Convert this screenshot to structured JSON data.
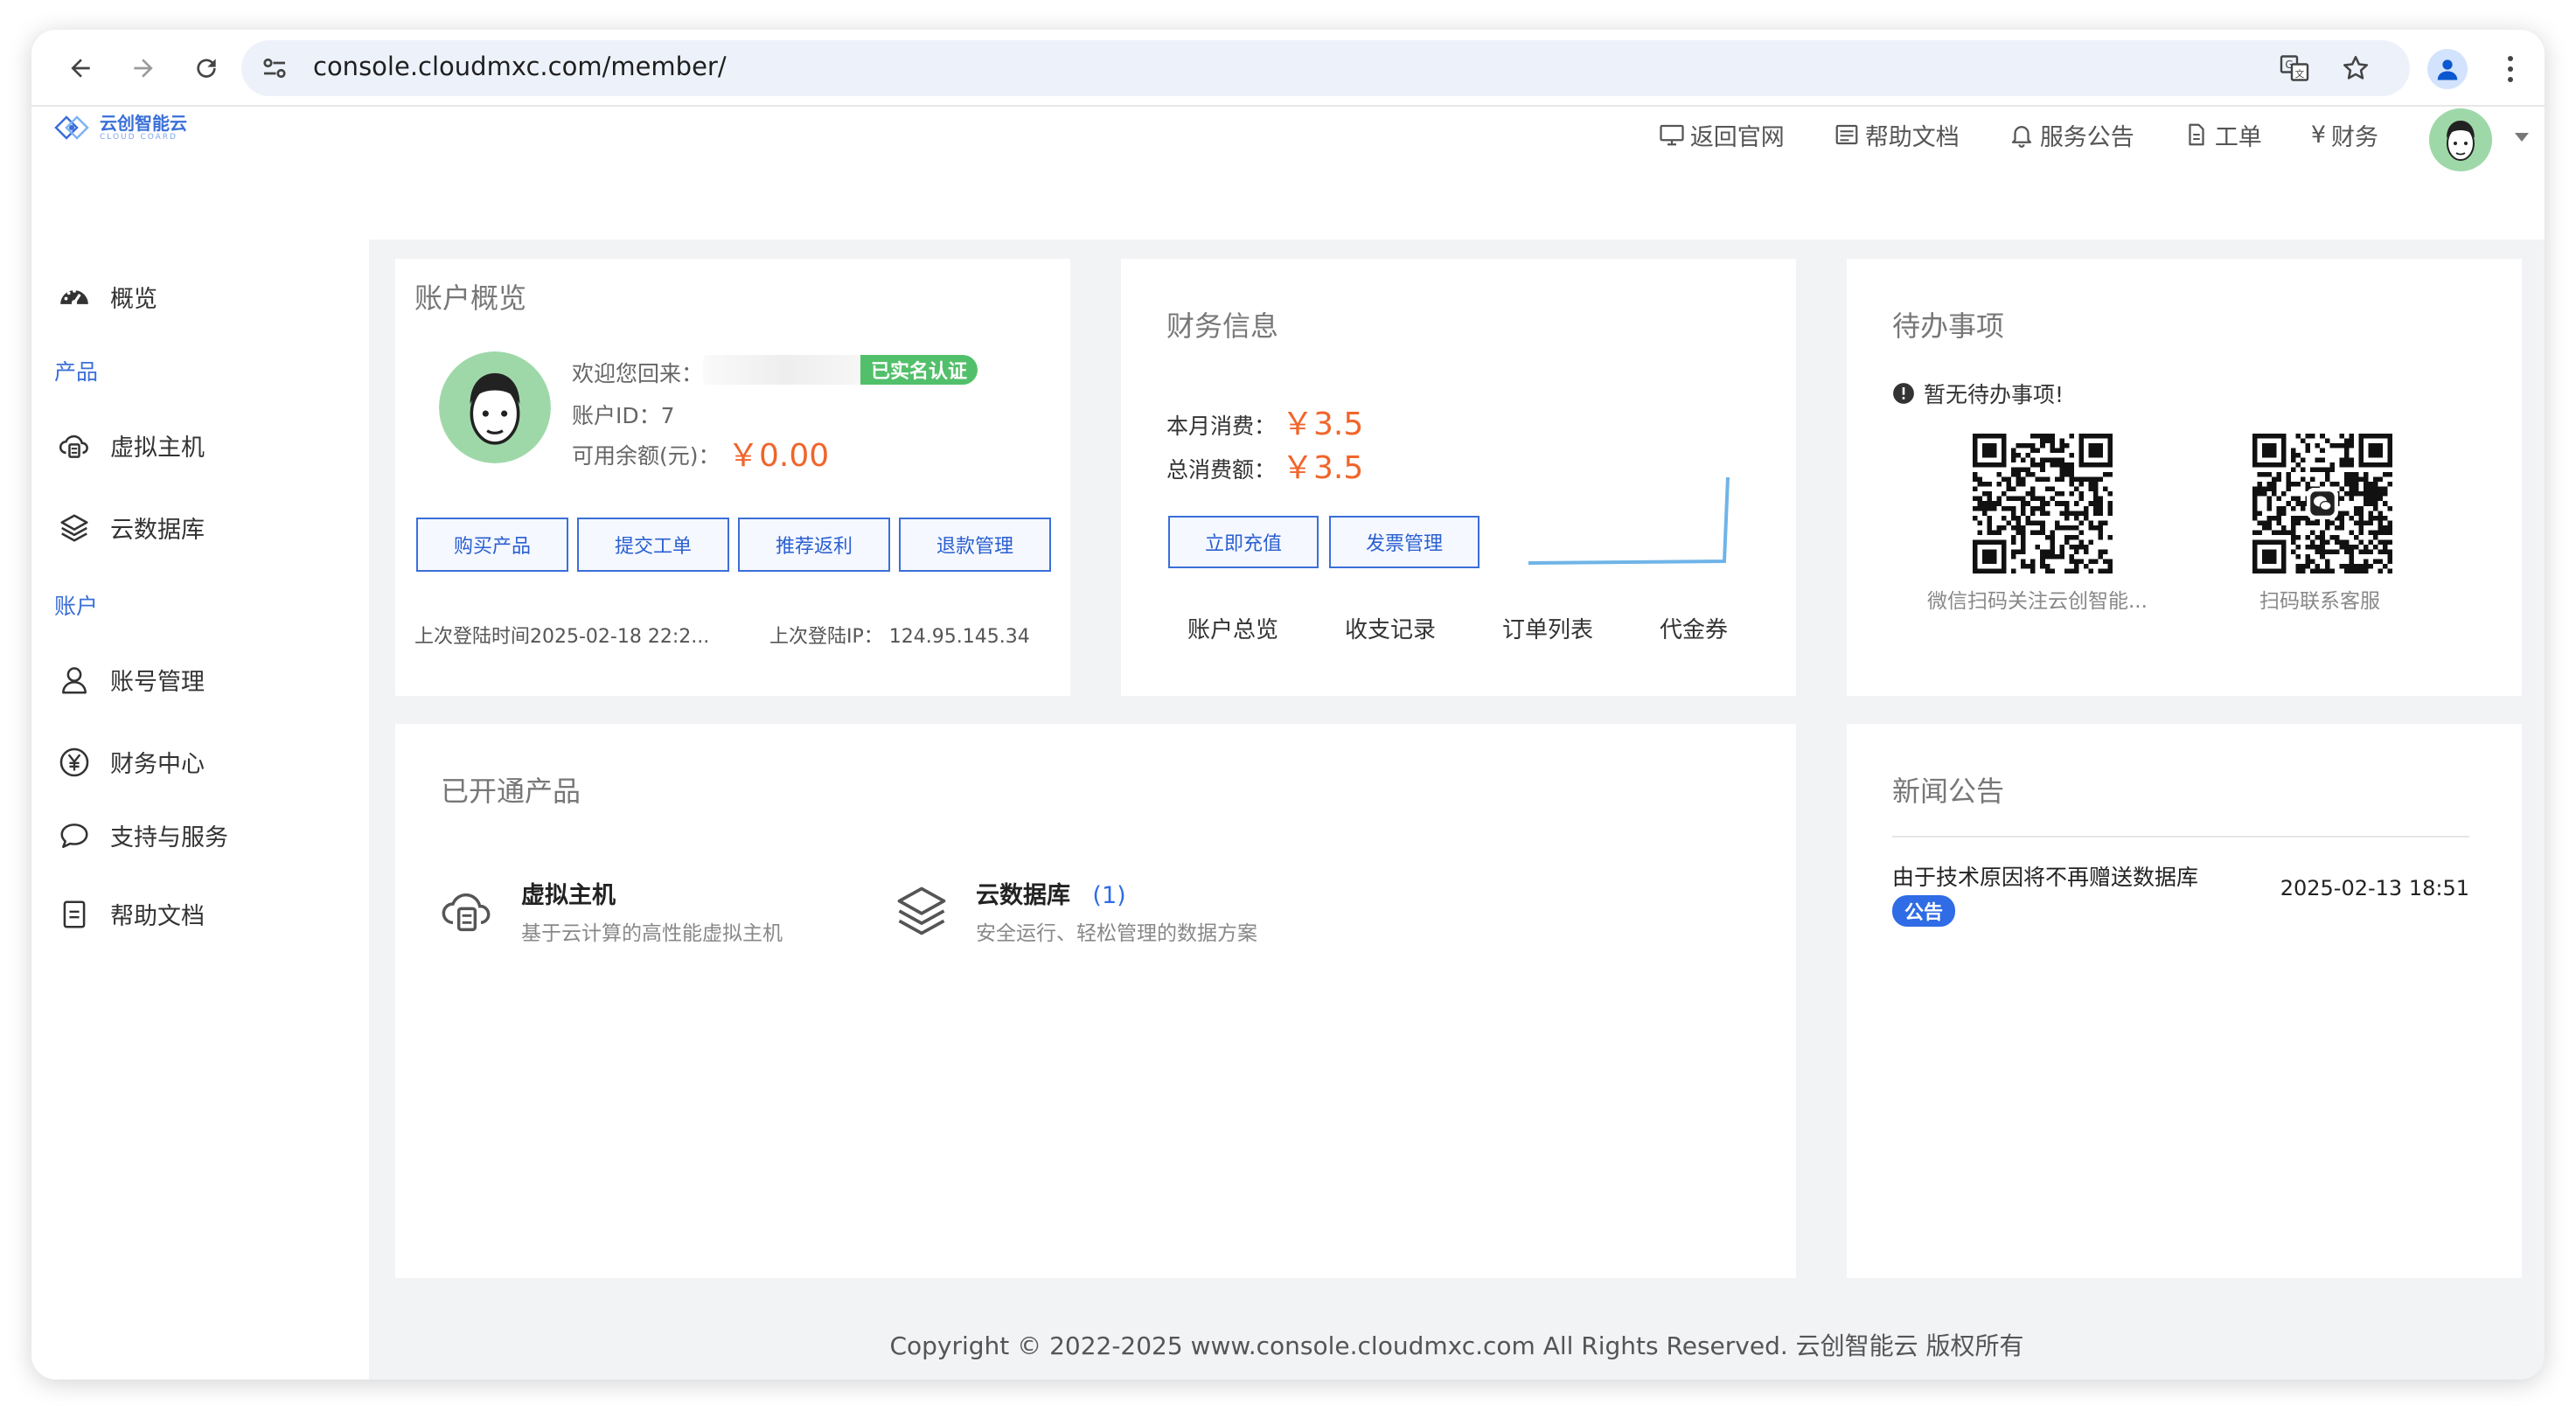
{
  "browser": {
    "url": "console.cloudmxc.com/member/"
  },
  "logo": {
    "cn": "云创智能云",
    "en": "CLOUD COARD"
  },
  "top_nav": [
    {
      "label": "返回官网",
      "icon": "monitor-icon"
    },
    {
      "label": "帮助文档",
      "icon": "document-list-icon"
    },
    {
      "label": "服务公告",
      "icon": "bell-icon"
    },
    {
      "label": "工单",
      "icon": "file-icon"
    },
    {
      "label": "财务",
      "icon": "yen-icon",
      "prefix": "¥"
    }
  ],
  "sidebar": {
    "overview": "概览",
    "group_products": "产品",
    "vm": "虚拟主机",
    "db": "云数据库",
    "group_account": "账户",
    "account_mgmt": "账号管理",
    "finance": "财务中心",
    "support": "支持与服务",
    "help": "帮助文档"
  },
  "account_card": {
    "title": "账户概览",
    "welcome": "欢迎您回来：",
    "verified": "已实名认证",
    "account_id_label": "账户ID：",
    "account_id": "7",
    "balance_label": "可用余额(元)：",
    "balance": "￥0.00",
    "buttons": [
      "购买产品",
      "提交工单",
      "推荐返利",
      "退款管理"
    ],
    "last_login_time": "上次登陆时间2025-02-18 22:2...",
    "last_login_ip_label": "上次登陆IP：",
    "last_login_ip": "124.95.145.34"
  },
  "finance_card": {
    "title": "财务信息",
    "month_label": "本月消费：",
    "month_value": "￥3.5",
    "total_label": "总消费额：",
    "total_value": "￥3.5",
    "recharge_button": "立即充值",
    "invoice_button": "发票管理",
    "links": [
      "账户总览",
      "收支记录",
      "订单列表",
      "代金券"
    ]
  },
  "todo_card": {
    "title": "待办事项",
    "empty": "暂无待办事项!",
    "qr1_caption": "微信扫码关注云创智能...",
    "qr2_caption": "扫码联系客服"
  },
  "products_card": {
    "title": "已开通产品",
    "items": [
      {
        "name": "虚拟主机",
        "count": "",
        "desc": "基于云计算的高性能虚拟主机"
      },
      {
        "name": "云数据库",
        "count": "(1)",
        "desc": "安全运行、轻松管理的数据方案"
      }
    ]
  },
  "news_card": {
    "title": "新闻公告",
    "items": [
      {
        "title": "由于技术原因将不再赠送数据库",
        "badge": "公告",
        "date": "2025-02-13 18:51"
      }
    ]
  },
  "footer": "Copyright © 2022-2025 www.console.cloudmxc.com All Rights Reserved. 云创智能云 版权所有",
  "colors": {
    "accent": "#3a6fd8",
    "money": "#f0652b",
    "verified": "#52c06a",
    "badge": "#2f6ce5"
  }
}
